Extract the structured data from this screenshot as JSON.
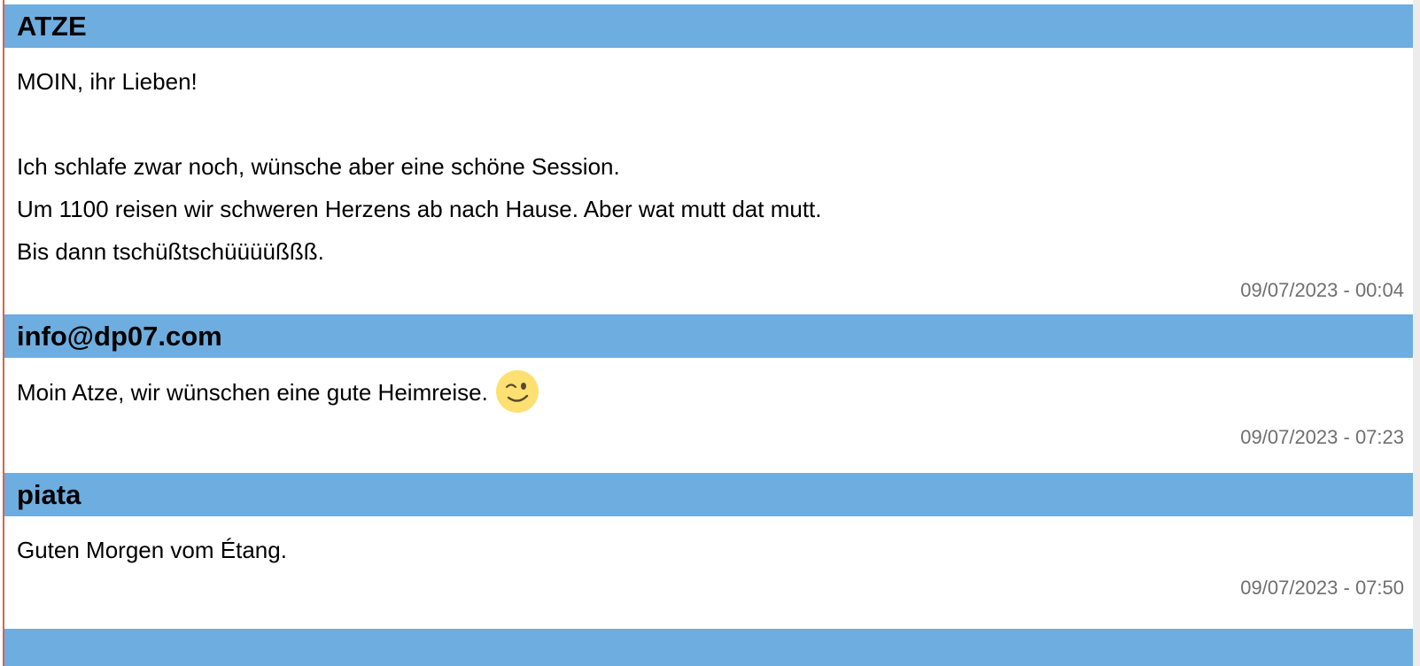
{
  "posts": [
    {
      "author": "ATZE",
      "lines": [
        "MOIN, ihr Lieben!",
        "",
        "Ich schlafe zwar noch, wünsche aber eine schöne Session.",
        "Um 1100 reisen wir schweren Herzens ab nach Hause. Aber wat mutt dat mutt.",
        "Bis dann tschüßtschüüüüßßß."
      ],
      "timestamp": "09/07/2023 - 00:04"
    },
    {
      "author": "info@dp07.com",
      "lines": [
        "Moin Atze, wir wünschen eine gute Heimreise."
      ],
      "emoji": "winking-face-icon",
      "timestamp": "09/07/2023 - 07:23"
    },
    {
      "author": "piata",
      "lines": [
        "Guten Morgen vom Étang."
      ],
      "timestamp": "09/07/2023 - 07:50"
    },
    {
      "author": "",
      "lines": [],
      "timestamp": ""
    }
  ],
  "colors": {
    "header_background": "#6eaddf",
    "timestamp_text": "#6f6f6f",
    "left_rule": "#d9634a"
  }
}
